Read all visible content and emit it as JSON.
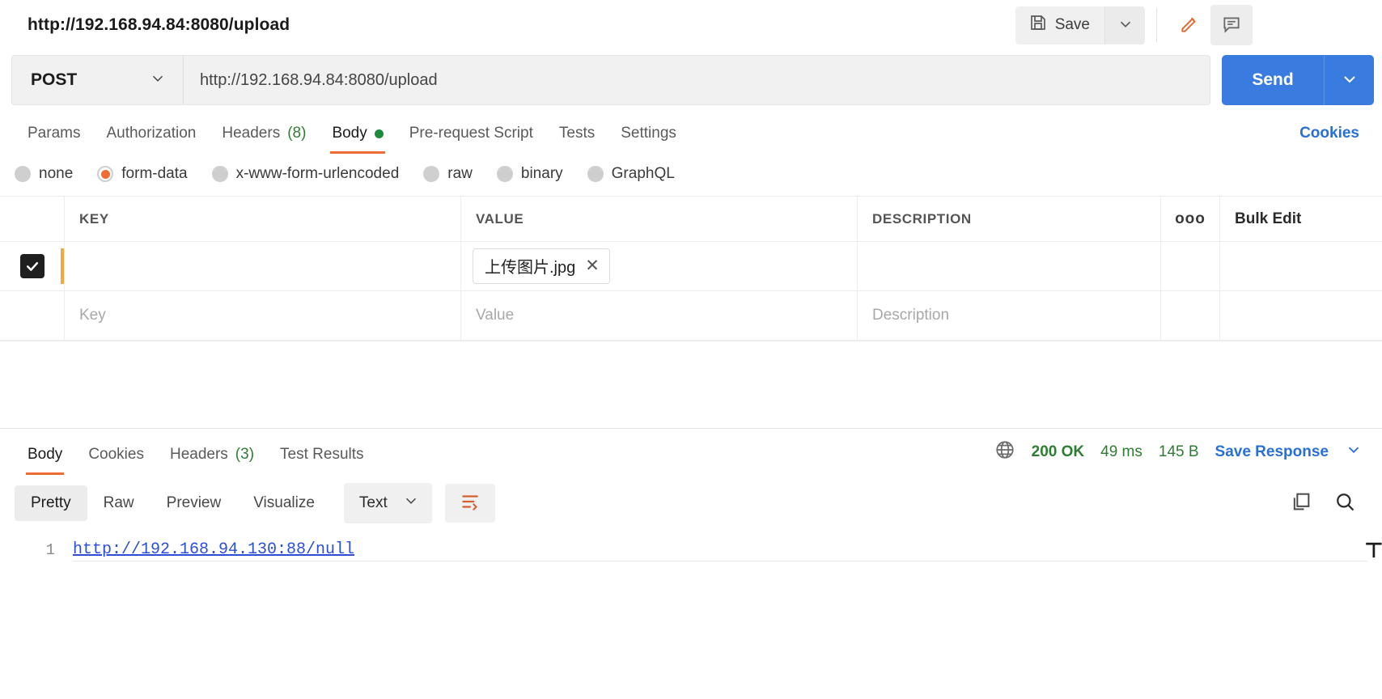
{
  "header": {
    "request_title": "http://192.168.94.84:8080/upload",
    "save_label": "Save",
    "save_icon": "floppy-disk-icon",
    "save_caret_icon": "chevron-down-icon",
    "edit_icon": "pencil-icon",
    "comment_icon": "comment-bubble-icon",
    "accent_orange": "#ef6c35"
  },
  "url_bar": {
    "method": "POST",
    "method_caret_icon": "chevron-down-icon",
    "url": "http://192.168.94.84:8080/upload",
    "send_label": "Send",
    "send_caret_icon": "chevron-down-icon",
    "send_color": "#3a7be0"
  },
  "request_tabs": {
    "items": [
      {
        "label": "Params",
        "active": false,
        "count": "",
        "dot": false
      },
      {
        "label": "Authorization",
        "active": false,
        "count": "",
        "dot": false
      },
      {
        "label": "Headers",
        "active": false,
        "count": "(8)",
        "dot": false
      },
      {
        "label": "Body",
        "active": true,
        "count": "",
        "dot": true
      },
      {
        "label": "Pre-request Script",
        "active": false,
        "count": "",
        "dot": false
      },
      {
        "label": "Tests",
        "active": false,
        "count": "",
        "dot": false
      },
      {
        "label": "Settings",
        "active": false,
        "count": "",
        "dot": false
      }
    ],
    "cookies_label": "Cookies"
  },
  "body_types": {
    "options": [
      {
        "label": "none",
        "selected": false
      },
      {
        "label": "form-data",
        "selected": true
      },
      {
        "label": "x-www-form-urlencoded",
        "selected": false
      },
      {
        "label": "raw",
        "selected": false
      },
      {
        "label": "binary",
        "selected": false
      },
      {
        "label": "GraphQL",
        "selected": false
      }
    ]
  },
  "form_table": {
    "columns": [
      "KEY",
      "VALUE",
      "DESCRIPTION"
    ],
    "options_icon": "more-options-icon",
    "bulk_edit_label": "Bulk Edit",
    "rows": [
      {
        "checked": true,
        "key": "",
        "value_file": "上传图片.jpg",
        "remove_icon": "close-icon",
        "description": ""
      }
    ],
    "placeholder_row": {
      "key": "Key",
      "value": "Value",
      "description": "Description"
    }
  },
  "response": {
    "tabs": [
      {
        "label": "Body",
        "active": true,
        "count": ""
      },
      {
        "label": "Cookies",
        "active": false,
        "count": ""
      },
      {
        "label": "Headers",
        "active": false,
        "count": "(3)"
      },
      {
        "label": "Test Results",
        "active": false,
        "count": ""
      }
    ],
    "globe_icon": "globe-icon",
    "status": "200 OK",
    "time": "49 ms",
    "size": "145 B",
    "save_response_label": "Save Response",
    "save_response_caret_icon": "chevron-down-icon",
    "view_tabs": [
      {
        "label": "Pretty",
        "active": true
      },
      {
        "label": "Raw",
        "active": false
      },
      {
        "label": "Preview",
        "active": false
      },
      {
        "label": "Visualize",
        "active": false
      }
    ],
    "format": "Text",
    "format_caret_icon": "chevron-down-icon",
    "wrap_icon": "word-wrap-icon",
    "copy_icon": "copy-icon",
    "search_icon": "search-icon",
    "body_lines": [
      {
        "number": "1",
        "text": "http://192.168.94.130:88/null"
      }
    ]
  }
}
